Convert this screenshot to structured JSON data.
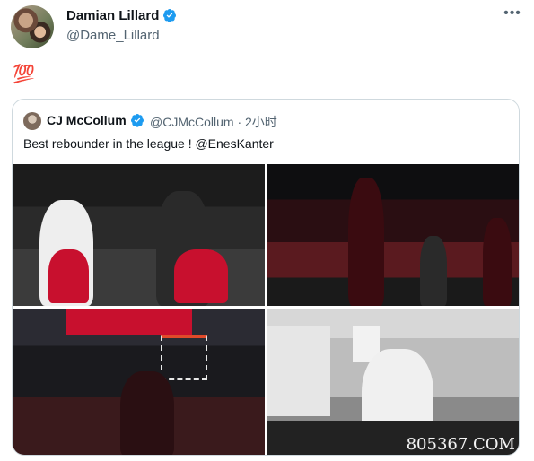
{
  "tweet": {
    "author_name": "Damian Lillard",
    "author_handle": "@Dame_Lillard",
    "more_icon": "more-horizontal-icon",
    "text": "💯",
    "verified_icon": "verified-badge-icon"
  },
  "quote": {
    "author_name": "CJ McCollum",
    "author_handle": "@CJMcCollum",
    "separator": "·",
    "time": "2小时",
    "handle_time": "@CJMcCollum · 2小时",
    "text": "Best rebounder in the league ! @EnesKanter"
  },
  "photos": [
    {
      "name": "photo-bench-players"
    },
    {
      "name": "photo-game-action"
    },
    {
      "name": "photo-rebound-dunk"
    },
    {
      "name": "photo-tunnel-dior-hoodie"
    }
  ],
  "watermark": "805367.COM",
  "colors": {
    "verified": "#1d9bf0",
    "text_primary": "#0f1419",
    "text_secondary": "#536471",
    "border": "#cfd9de",
    "blazers_red": "#c8102e"
  }
}
